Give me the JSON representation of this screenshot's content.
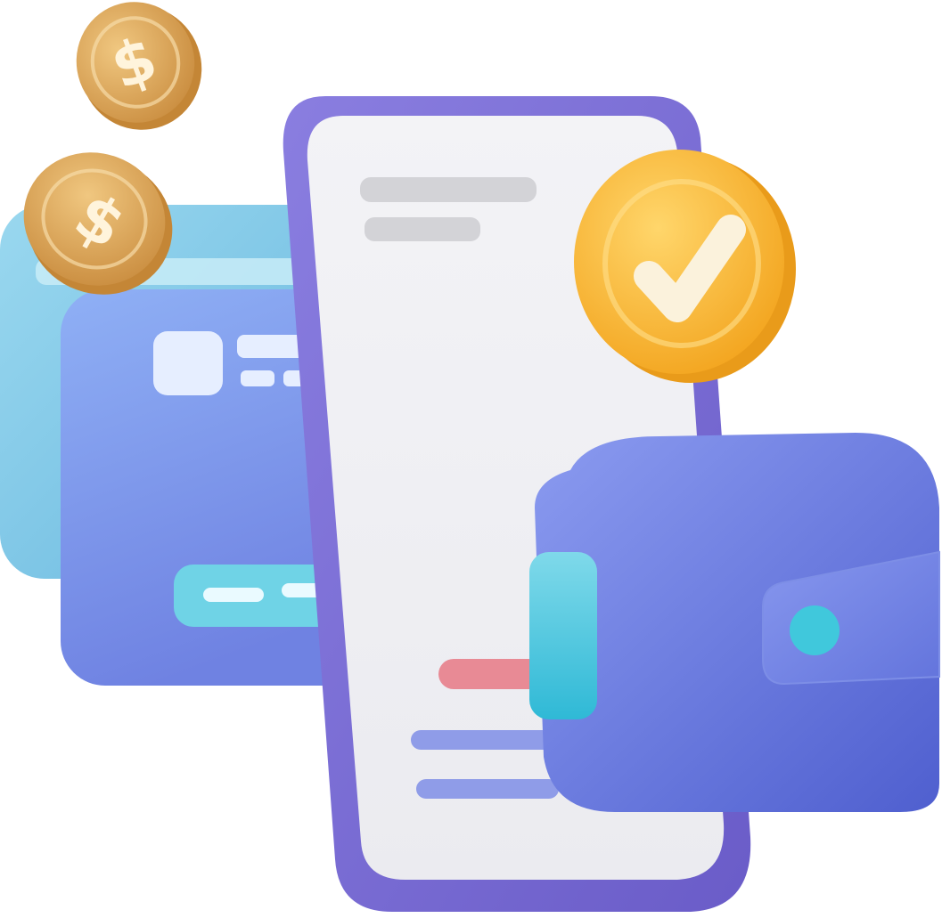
{
  "illustration": {
    "subject": "mobile payment",
    "coin_symbol": "$",
    "colors": {
      "card_back": "#7fcbe8",
      "card_front": "#7e9cf0",
      "phone_frame": "#7b6fd0",
      "phone_screen": "#efeff3",
      "placeholder_gray": "#d2d2d6",
      "accent_red": "#e88a95",
      "accent_line": "#8f9ce8",
      "check_coin": "#f7b733",
      "wallet": "#6d7fe0",
      "wallet_tab": "#45c6dd",
      "coin_gold": "#dca45a"
    }
  }
}
